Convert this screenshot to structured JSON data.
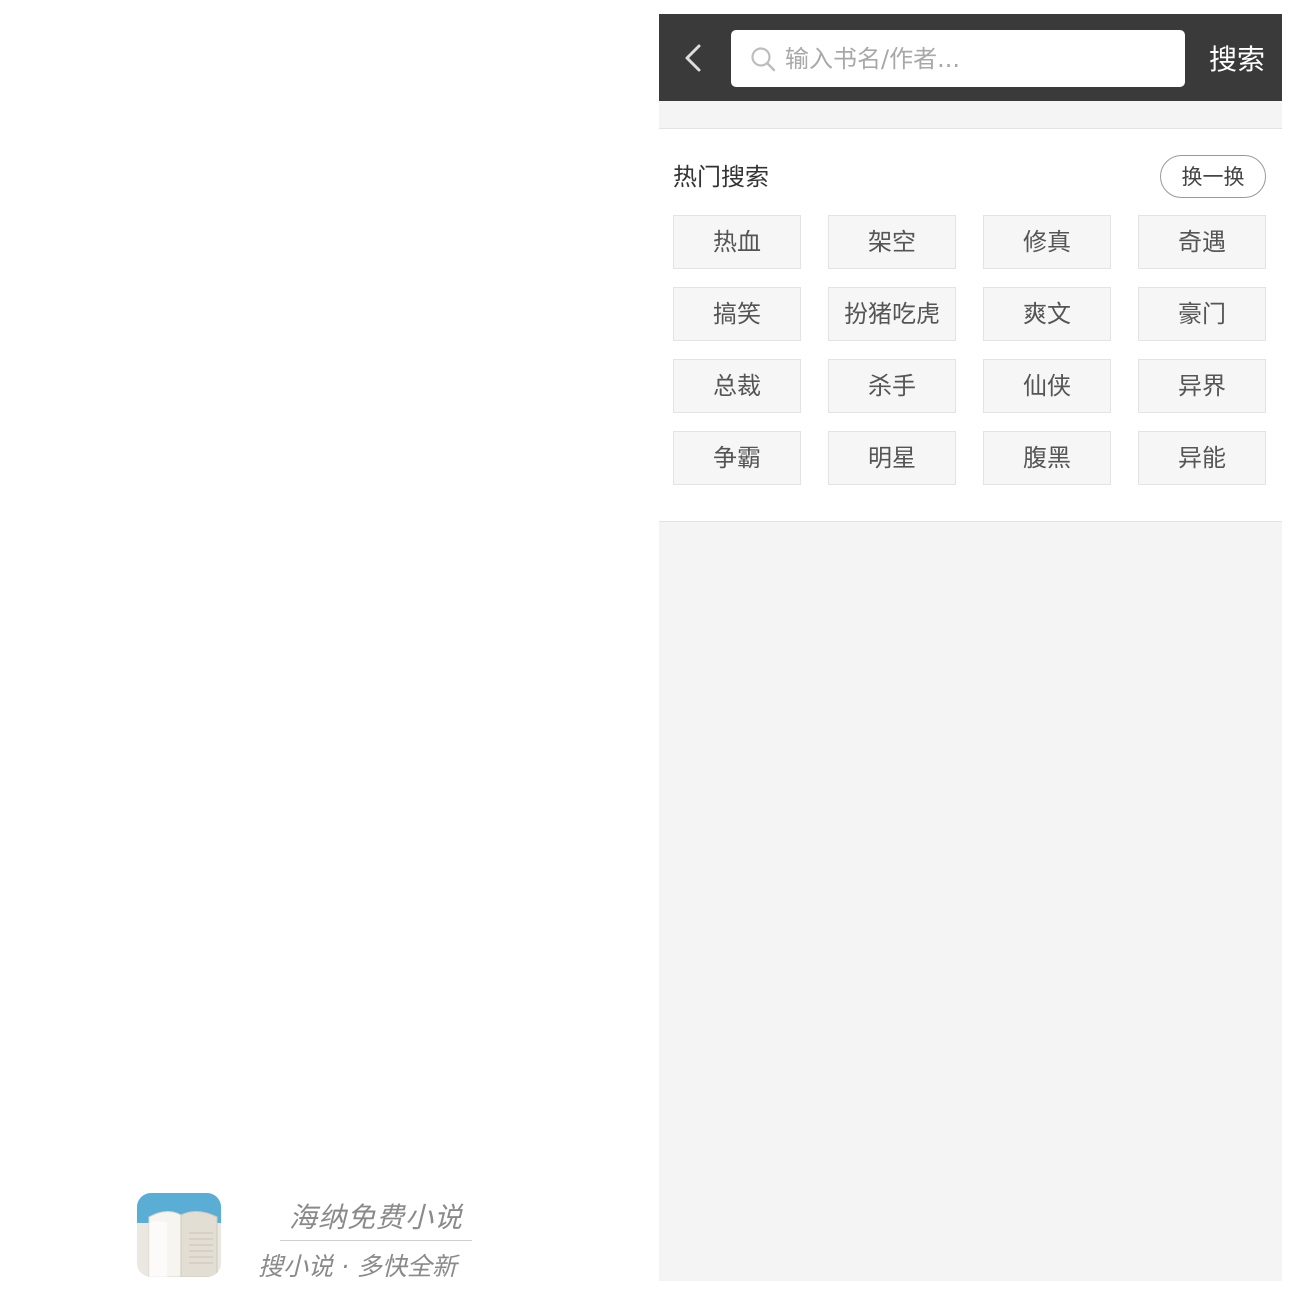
{
  "splash": {
    "app_name": "海纳免费小说",
    "slogan": "搜小说 · 多快全新",
    "logo_icon": "open-book-icon"
  },
  "search_screen": {
    "back_icon": "chevron-left-icon",
    "search_icon": "search-icon",
    "search_placeholder": "输入书名/作者...",
    "search_value": "",
    "search_button_label": "搜索",
    "hot_search": {
      "title": "热门搜索",
      "refresh_label": "换一换",
      "tags": [
        "热血",
        "架空",
        "修真",
        "奇遇",
        "搞笑",
        "扮猪吃虎",
        "爽文",
        "豪门",
        "总裁",
        "杀手",
        "仙侠",
        "异界",
        "争霸",
        "明星",
        "腹黑",
        "异能"
      ]
    }
  },
  "colors": {
    "topbar_bg": "#3a3a3a",
    "screen_bg": "#f4f4f4",
    "tag_bg": "#f6f6f6",
    "logo_blue": "#5aaed6"
  }
}
